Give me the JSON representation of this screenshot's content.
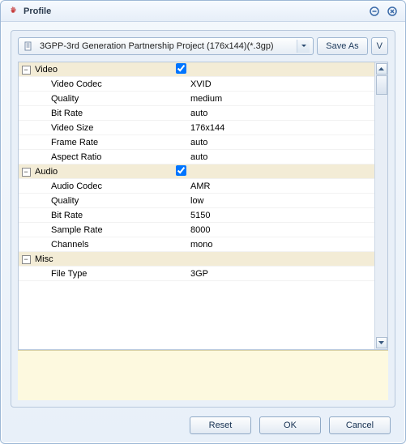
{
  "window": {
    "title": "Profile"
  },
  "toolbar": {
    "profile_selected": "3GPP-3rd Generation Partnership Project (176x144)(*.3gp)",
    "save_as_label": "Save As",
    "v_label": "V"
  },
  "groups": {
    "video": {
      "label": "Video",
      "checked": true,
      "rows": [
        {
          "label": "Video Codec",
          "value": "XVID"
        },
        {
          "label": "Quality",
          "value": "medium"
        },
        {
          "label": "Bit Rate",
          "value": "auto"
        },
        {
          "label": "Video Size",
          "value": "176x144"
        },
        {
          "label": "Frame Rate",
          "value": "auto"
        },
        {
          "label": "Aspect Ratio",
          "value": "auto"
        }
      ]
    },
    "audio": {
      "label": "Audio",
      "checked": true,
      "rows": [
        {
          "label": "Audio Codec",
          "value": "AMR"
        },
        {
          "label": "Quality",
          "value": "low"
        },
        {
          "label": "Bit Rate",
          "value": "5150"
        },
        {
          "label": "Sample Rate",
          "value": "8000"
        },
        {
          "label": "Channels",
          "value": "mono"
        }
      ]
    },
    "misc": {
      "label": "Misc",
      "rows": [
        {
          "label": "File Type",
          "value": "3GP"
        }
      ]
    }
  },
  "footer": {
    "reset_label": "Reset",
    "ok_label": "OK",
    "cancel_label": "Cancel"
  }
}
